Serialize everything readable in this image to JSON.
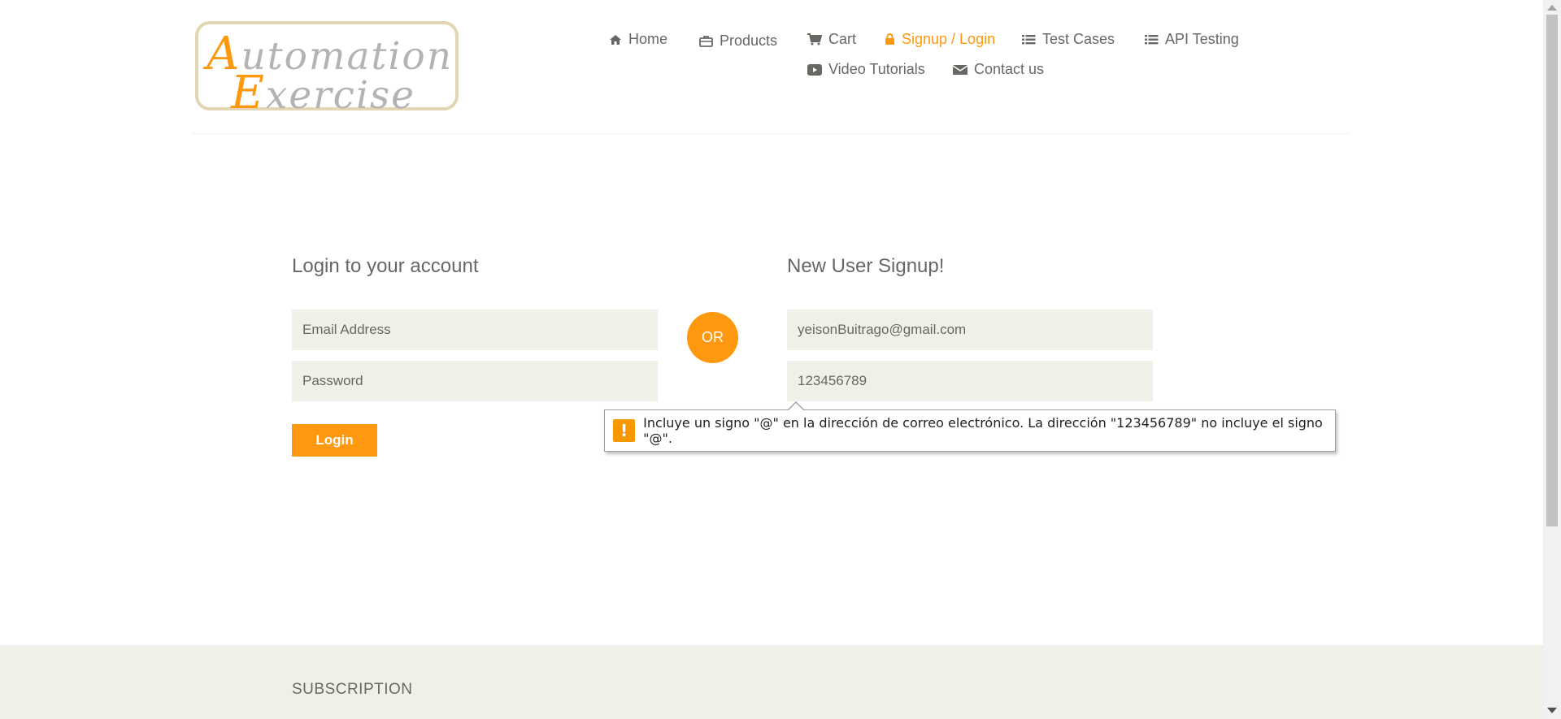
{
  "logo": {
    "cap1": "A",
    "rest1": "utomation",
    "cap2": "E",
    "rest2": "xercise"
  },
  "nav": [
    {
      "label": "Home",
      "icon": "home-icon"
    },
    {
      "label": "Products",
      "icon": "briefcase-icon"
    },
    {
      "label": "Cart",
      "icon": "cart-icon"
    },
    {
      "label": "Signup / Login",
      "icon": "lock-icon",
      "active": true
    },
    {
      "label": "Test Cases",
      "icon": "list-icon"
    },
    {
      "label": "API Testing",
      "icon": "list-icon"
    },
    {
      "label": "Video Tutorials",
      "icon": "youtube-play-icon"
    },
    {
      "label": "Contact us",
      "icon": "envelope-icon"
    }
  ],
  "login": {
    "title": "Login to your account",
    "email_placeholder": "Email Address",
    "password_placeholder": "Password",
    "button_label": "Login"
  },
  "or_label": "OR",
  "signup": {
    "title": "New User Signup!",
    "name_value": "yeisonBuitrago@gmail.com",
    "email_value": "123456789"
  },
  "validation": {
    "icon": "warning-icon",
    "message": "Incluye un signo \"@\" en la dirección de correo electrónico. La dirección \"123456789\" no incluye el signo \"@\"."
  },
  "footer": {
    "title": "SUBSCRIPTION"
  },
  "colors": {
    "accent": "#fe980f",
    "text": "#696763",
    "input_bg": "#f0f0e9"
  }
}
